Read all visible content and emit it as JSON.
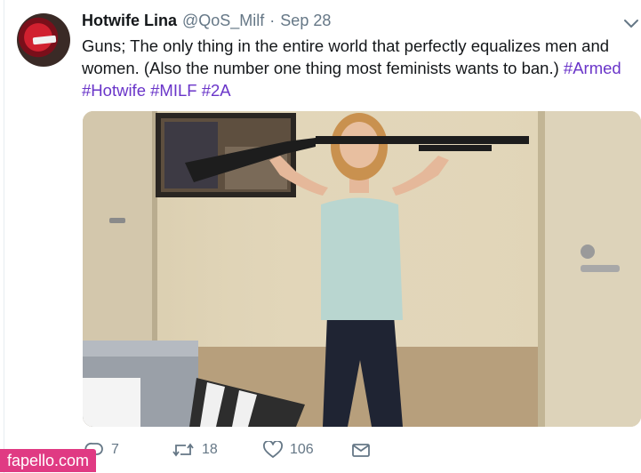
{
  "tweet": {
    "display_name": "Hotwife Lina",
    "handle": "@QoS_Milf",
    "separator": "·",
    "timestamp": "Sep 28",
    "text_main": "Guns; The only thing in the entire world that perfectly equalizes men and women. (Also the number one thing most feminists wants to ban.)",
    "hashtags": [
      "#Armed",
      "#Hotwife",
      "#MILF",
      "#2A"
    ]
  },
  "actions": {
    "reply_count": "7",
    "retweet_count": "18",
    "like_count": "106"
  },
  "watermark": "fapello.com",
  "colors": {
    "hashtag": "#6a35c9",
    "meta_text": "#657786",
    "primary_text": "#14171a",
    "watermark_bg": "#e03a83"
  },
  "icons": {
    "caret": "chevron-down-icon",
    "reply": "reply-icon",
    "retweet": "retweet-icon",
    "like": "heart-icon",
    "dm": "envelope-icon"
  }
}
